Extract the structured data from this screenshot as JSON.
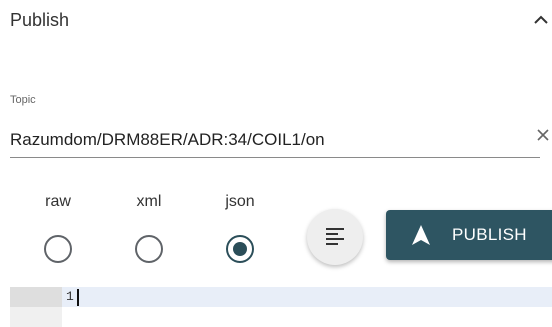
{
  "panel": {
    "title": "Publish"
  },
  "topic": {
    "label": "Topic",
    "value": "Razumdom/DRM88ER/ADR:34/COIL1/on"
  },
  "format": {
    "options": [
      {
        "label": "raw",
        "selected": false
      },
      {
        "label": "xml",
        "selected": false
      },
      {
        "label": "json",
        "selected": true
      }
    ]
  },
  "actions": {
    "publish_label": "PUBLISH",
    "format_icon": "format-align-icon",
    "publish_icon": "navigation-arrow-icon"
  },
  "editor": {
    "line_numbers": [
      "1"
    ],
    "content": ""
  },
  "colors": {
    "accent": "#2e5562",
    "editor_active_line": "#e8eef8"
  }
}
